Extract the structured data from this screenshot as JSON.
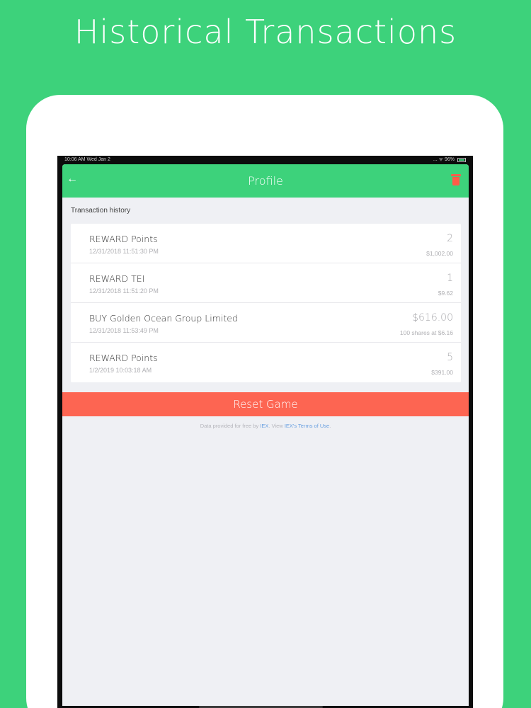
{
  "headline": "Historical Transactions",
  "status_bar": {
    "time_date": "10:06 AM   Wed Jan 2",
    "right": "...  ᯤ 96%"
  },
  "navbar": {
    "back_icon": "arrow-left-icon",
    "title": "Profile",
    "action_icon": "trash-icon"
  },
  "section_title": "Transaction history",
  "transactions": [
    {
      "title": "REWARD Points",
      "date": "12/31/2018 11:51:30 PM",
      "value": "2",
      "sub": "$1,002.00"
    },
    {
      "title": "REWARD TEI",
      "date": "12/31/2018 11:51:20 PM",
      "value": "1",
      "sub": "$9.62"
    },
    {
      "title": "BUY Golden Ocean Group Limited",
      "date": "12/31/2018 11:53:49 PM",
      "value": "$616.00",
      "sub": "100 shares at $6.16"
    },
    {
      "title": "REWARD Points",
      "date": "1/2/2019 10:03:18 AM",
      "value": "5",
      "sub": "$391.00"
    }
  ],
  "reset_button": "Reset Game",
  "attribution": {
    "prefix": "Data provided for free by",
    "iex": "IEX",
    "middle": ". View",
    "terms": "IEX's Terms of Use",
    "suffix": "."
  },
  "colors": {
    "brand_green": "#3dd27b",
    "reset_red": "#fd6552",
    "trash_red": "#ff5c48",
    "link_blue": "#6aa0e0"
  }
}
